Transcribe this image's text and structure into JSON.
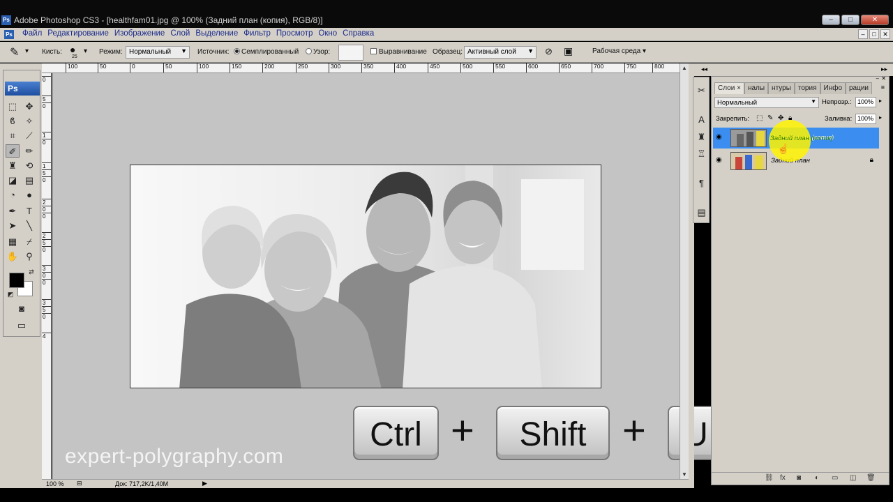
{
  "window": {
    "app_icon": "Ps",
    "title": "Adobe Photoshop CS3 - [healthfam01.jpg @ 100% (Задний план (копия), RGB/8)]",
    "controls": [
      "–",
      "□",
      "✕"
    ]
  },
  "menu": {
    "items": [
      "Файл",
      "Редактирование",
      "Изображение",
      "Слой",
      "Выделение",
      "Фильтр",
      "Просмотр",
      "Окно",
      "Справка"
    ],
    "mdi_controls": [
      "–",
      "□",
      "✕"
    ]
  },
  "options": {
    "brush_label": "Кисть:",
    "brush_size": "25",
    "mode_label": "Режим:",
    "mode_value": "Нормальный",
    "source_label": "Источник:",
    "source_sampled": "Семплированный",
    "source_pattern": "Узор:",
    "aligned_label": "Выравнивание",
    "sample_label": "Образец:",
    "sample_value": "Активный слой",
    "workspace_label": "Рабочая среда"
  },
  "toolbox": {
    "logo": "Ps"
  },
  "ruler": {
    "top_marks": [
      "100",
      "50",
      "0",
      "50",
      "100",
      "150",
      "200",
      "250",
      "300",
      "350",
      "400",
      "450",
      "500",
      "550",
      "600",
      "650",
      "700",
      "750",
      "800"
    ],
    "left_marks": [
      "0",
      "5",
      "0",
      "1",
      "0",
      "1",
      "5",
      "0",
      "2",
      "0",
      "0",
      "2",
      "5",
      "0",
      "3",
      "0",
      "0",
      "3",
      "5",
      "0",
      "4"
    ]
  },
  "status": {
    "zoom": "100 %",
    "doc": "Док: 717,2K/1,40M"
  },
  "overlay": {
    "keys": [
      "Ctrl",
      "Shift",
      "U"
    ],
    "plus": "+",
    "watermark": "expert-polygraphy.com"
  },
  "layers_panel": {
    "tabs": [
      "Слои ×",
      "налы",
      "нтуры",
      "тория",
      "Инфо",
      "рации"
    ],
    "blend_mode": "Нормальный",
    "opacity_label": "Непрозр.:",
    "opacity_value": "100%",
    "lock_label": "Закрепить:",
    "fill_label": "Заливка:",
    "fill_value": "100%",
    "layers": [
      {
        "name": "Задний план (копия)",
        "selected": true
      },
      {
        "name": "Задний план",
        "selected": false
      }
    ],
    "selected_color": "#3b8ef0"
  }
}
